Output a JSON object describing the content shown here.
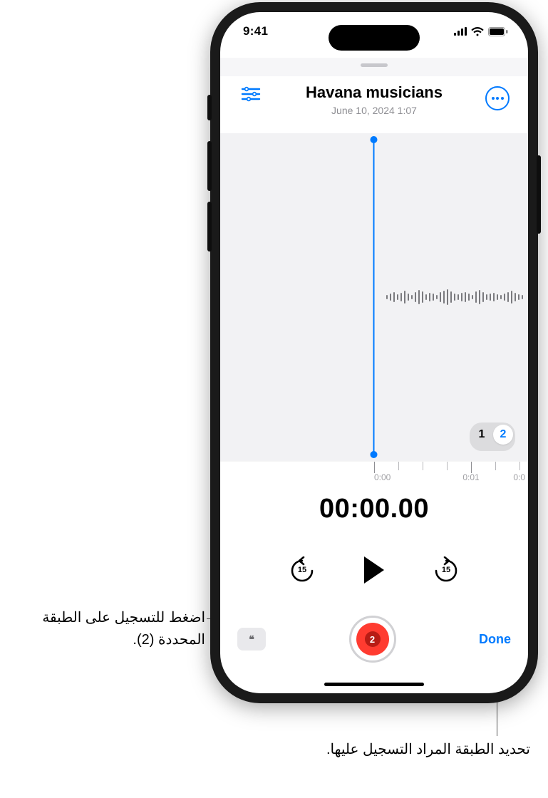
{
  "status": {
    "time": "9:41"
  },
  "header": {
    "title": "Havana musicians",
    "subtitle": "June 10, 2024  1:07"
  },
  "layers": {
    "options": [
      "1",
      "2"
    ],
    "selected": "2"
  },
  "timeline": {
    "labels": [
      "0:00",
      "0:01",
      "0:0"
    ]
  },
  "timer": "00:00.00",
  "controls": {
    "skip_back_amount": "15",
    "skip_fwd_amount": "15"
  },
  "bottom": {
    "record_layer_badge": "2",
    "done_label": "Done",
    "transcript_glyph": "❝"
  },
  "callouts": {
    "record": "اضغط للتسجيل على الطبقة المحددة (2).",
    "layer": "تحديد الطبقة المراد التسجيل عليها."
  }
}
